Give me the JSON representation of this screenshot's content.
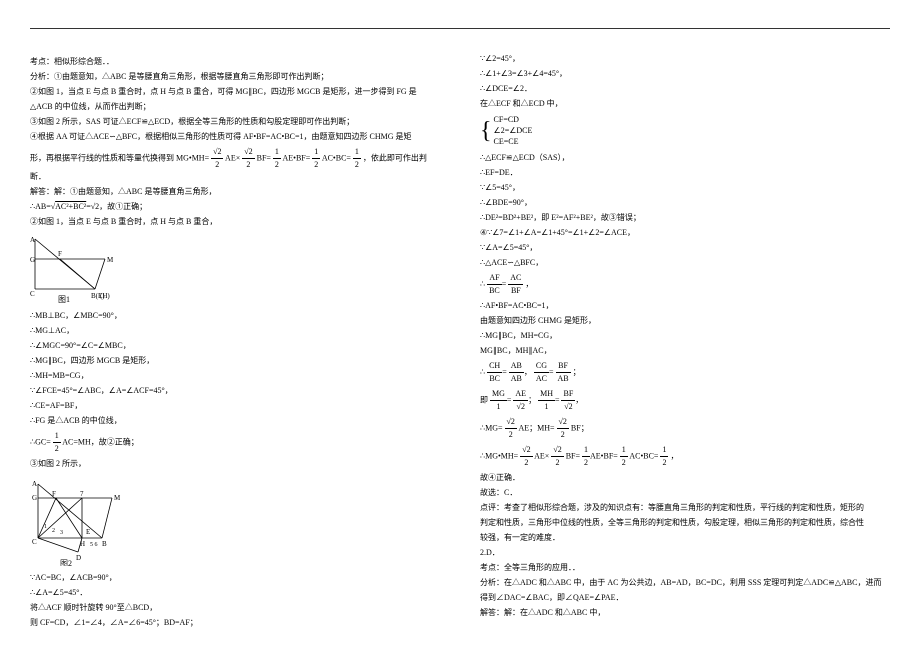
{
  "top": {
    "l1": "考点：相似形综合题．．",
    "l2": "分析：①由题意知，△ABC 是等腰直角三角形，根据等腰直角三角形即可作出判断；",
    "l3": "②如图 1，当点 E 与点 B 重合时，点 H 与点 B 重合，可得 MG∥BC，四边形 MGCB 是矩形，进一步得到 FG 是",
    "l4": "△ACB 的中位线，从而作出判断；",
    "l5": "③如图 2 所示，SAS 可证△ECF≌△ECD，根据全等三角形的性质和勾股定理即可作出判断；",
    "l6": "④根据 AA 可证△ACE∽△BFC，根据相似三角形的性质可得 AF•BF=AC•BC=1，由题意知四边形 CHMG 是矩",
    "l7": "形，再根据平行线的性质和等量代换得到 MG•MH=",
    "frac_expr": "AE×BF=2AE•BF=2AC•BC=",
    "tail7": "，依此即可作出判断．",
    "l8": "解答：解：①由题意知，△ABC 是等腰直角三角形，"
  },
  "ab_line": {
    "pre": "∴AB=",
    "inner": "AC²+BC²",
    "post": "=√2，故①正确；"
  },
  "sec2": {
    "h": "②如图 1，当点 E 与点 B 重合时，点 H 与点 B 重合，",
    "fig_label": "图1",
    "a1": "∴MB⊥BC，∠MBC=90°，",
    "a2": "∴MG⊥AC，",
    "a3": "∴∠MGC=90°=∠C=∠MBC，",
    "a4": "∴MG∥BC，四边形 MGCB 是矩形，",
    "a5": "∴MH=MB=CG，",
    "a6": "∵∠FCE=45°=∠ABC，∠A=∠ACF=45°，",
    "a7": "∴CE=AF=BF，",
    "a8": "∴FG 是△ACB 的中位线，",
    "a9_pre": "∴GC=",
    "a9_frac_n": "1",
    "a9_frac_d": "2",
    "a9_post": "AC=MH，故②正确；",
    "a10": "③如图 2 所示，"
  },
  "fig2_label": "图2",
  "after_fig2": {
    "b1": "∵AC=BC，∠ACB=90°，",
    "b2": "∴∠A=∠5=45°．",
    "b3": "将△ACF 顺时针旋转 90°至△BCD，"
  },
  "col2": {
    "c1": "则 CF=CD，∠1=∠4，∠A=∠6=45°；BD=AF；",
    "c2": "∵∠2=45°，",
    "c3": "∴∠1+∠3=∠3+∠4=45°，",
    "c4": "∴∠DCE=∠2．",
    "c5": "在△ECF 和△ECD 中，",
    "case1": "CF=CD",
    "case2": "∠2=∠DCE",
    "case3": "CE=CE",
    "c6": "∴△ECF≌△ECD（SAS），",
    "c7": "∴EF=DE．",
    "c8": "∵∠5=45°，",
    "c9": "∴∠BDE=90°，",
    "c10": "∴DE²=BD²+BE²，即 E²=AF²+BE²，故③错误；",
    "c11": "④∵∠7=∠1+∠A=∠1+45°=∠1+∠2=∠ACE，",
    "c12": "∵∠A=∠5=45°，",
    "c13": "∴△ACE∽△BFC，",
    "c14_n": "AF   AC",
    "c14_d": "BC=BF",
    "c14": "∴",
    "c14b": "，",
    "c15": "∴AF•BF=AC•BC=1，",
    "c16": "由题意知四边形 CHMG 是矩形，",
    "c17": "∴MG∥BC，MH=CG，",
    "c18": "MG∥BC，MH∥AC，",
    "r1a": "CH",
    "r1b": "AB",
    "r1c": "CG",
    "r1d": "AC",
    "r1e": "BF",
    "r1f": "AB",
    "c19_pre": "∴",
    "c19_mid": "=",
    "c19_post": "；",
    "r2a": "MG",
    "r2b": "1",
    "r2c": "AE",
    "r2d": "√2",
    "r2e": "MH",
    "r2f": "1",
    "r2g": "BF",
    "r2h": "√2",
    "c20_pre": "即",
    "c20_eq": "=",
    "c20_c": "；",
    "c21_pre": "∴MG=",
    "c21_m": " AE；MH=",
    "c21_post": " BF；",
    "c22_pre": "∴MG•MH=",
    "c22_mid": "AE×",
    "c22_mid2": "BF=",
    "c22_post": "AC•BC=",
    "c22_end": "，",
    "c23": "故④正确．",
    "c24": "故选：C．",
    "c25": "点评：考查了相似形综合题，涉及的知识点有：等腰直角三角形的判定和性质，平行线的判定和性质，矩形的",
    "c26": "判定和性质，三角形中位线的性质，全等三角形的判定和性质，勾股定理，相似三角形的判定和性质，综合性",
    "c27": "较强，有一定的难度．"
  },
  "q2": {
    "h": "2.D．",
    "l1": "考点：全等三角形的应用．．",
    "l2": "分析：在△ADC 和△ABC 中，由于 AC 为公共边，AB=AD，BC=DC，利用 SSS 定理可判定△ADC≌△ABC，进而",
    "l3": "得到∠DAC=∠BAC，即∠QAE=∠PAE．",
    "l4": "解答：解：在△ADC 和△ABC 中，"
  },
  "sqrt2": "√2",
  "half": "1",
  "two": "2"
}
